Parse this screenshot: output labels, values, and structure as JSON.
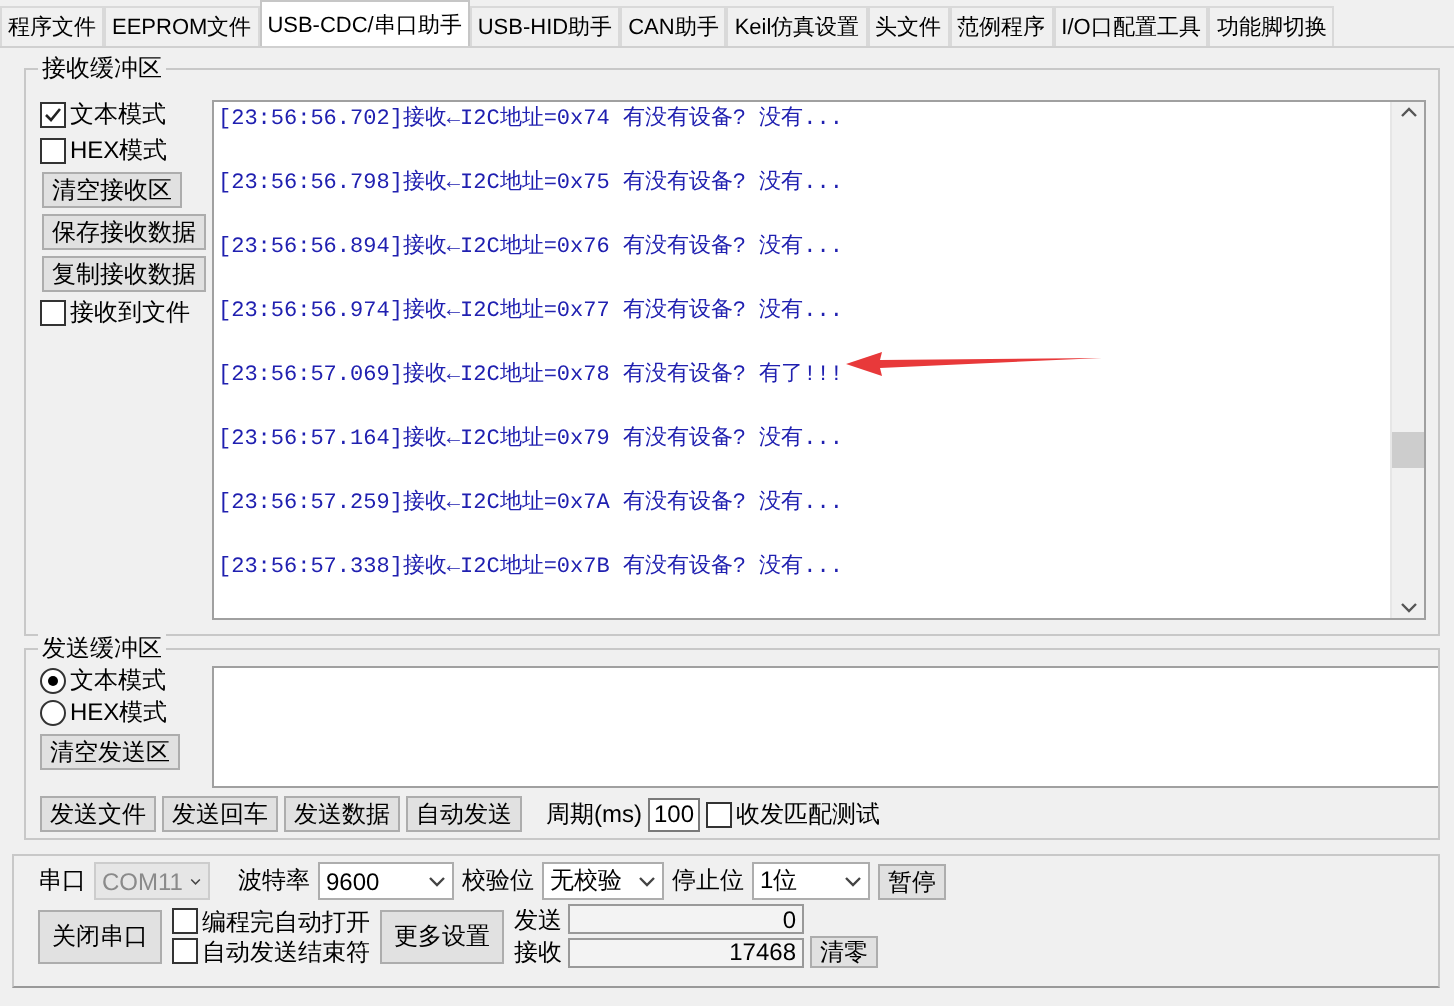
{
  "tabs": [
    {
      "label": "程序文件",
      "selected": false
    },
    {
      "label": "EEPROM文件",
      "selected": false
    },
    {
      "label": "USB-CDC/串口助手",
      "selected": true
    },
    {
      "label": "USB-HID助手",
      "selected": false
    },
    {
      "label": "CAN助手",
      "selected": false
    },
    {
      "label": "Keil仿真设置",
      "selected": false
    },
    {
      "label": "头文件",
      "selected": false
    },
    {
      "label": "范例程序",
      "selected": false
    },
    {
      "label": "I/O口配置工具",
      "selected": false
    },
    {
      "label": "功能脚切换",
      "selected": false
    }
  ],
  "receive": {
    "title": "接收缓冲区",
    "options": [
      {
        "kind": "checkbox",
        "label": "文本模式",
        "checked": true
      },
      {
        "kind": "checkbox",
        "label": "HEX模式",
        "checked": false
      },
      {
        "kind": "button",
        "label": "清空接收区"
      },
      {
        "kind": "button",
        "label": "保存接收数据"
      },
      {
        "kind": "button",
        "label": "复制接收数据"
      },
      {
        "kind": "checkbox",
        "label": "接收到文件",
        "checked": false
      }
    ],
    "log": [
      "[23:56:56.702]接收←I2C地址=0x74 有没有设备? 没有...",
      "[23:56:56.798]接收←I2C地址=0x75 有没有设备? 没有...",
      "[23:56:56.894]接收←I2C地址=0x76 有没有设备? 没有...",
      "[23:56:56.974]接收←I2C地址=0x77 有没有设备? 没有...",
      "[23:56:57.069]接收←I2C地址=0x78 有没有设备? 有了!!!",
      "[23:56:57.164]接收←I2C地址=0x79 有没有设备? 没有...",
      "[23:56:57.259]接收←I2C地址=0x7A 有没有设备? 没有...",
      "[23:56:57.338]接收←I2C地址=0x7B 有没有设备? 没有..."
    ]
  },
  "send": {
    "title": "发送缓冲区",
    "options": [
      {
        "kind": "radio",
        "label": "文本模式",
        "selected": true
      },
      {
        "kind": "radio",
        "label": "HEX模式",
        "selected": false
      },
      {
        "kind": "button",
        "label": "清空发送区"
      }
    ],
    "buttons": [
      "发送文件",
      "发送回车",
      "发送数据",
      "自动发送"
    ],
    "period_label": "周期(ms)",
    "period": "100",
    "match_test": {
      "label": "收发匹配测试",
      "checked": false
    }
  },
  "port": {
    "port_label": "串口",
    "port": {
      "value": "COM11",
      "disabled": true
    },
    "baud_label": "波特率",
    "baud": "9600",
    "parity_label": "校验位",
    "parity": "无校验",
    "stop_label": "停止位",
    "stop": "1位",
    "pause": "暂停",
    "close": "关闭串口",
    "checks": [
      {
        "label": "编程完自动打开",
        "checked": false
      },
      {
        "label": "自动发送结束符",
        "checked": false
      }
    ],
    "more": "更多设置",
    "sent_label": "发送",
    "sent": "0",
    "recv_label": "接收",
    "received": "17468",
    "reset": "清零"
  }
}
